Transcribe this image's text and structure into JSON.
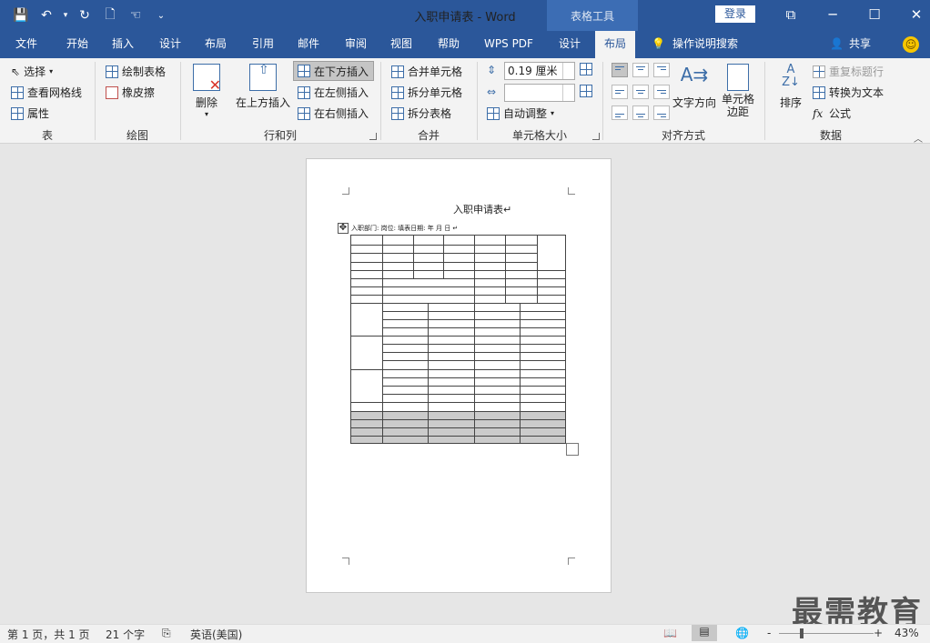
{
  "titlebar": {
    "document_title": "入职申请表 - Word",
    "context_title": "表格工具",
    "login_label": "登录",
    "qat_icons": [
      "save-icon",
      "undo-icon",
      "dropdown-caret-icon",
      "redo-icon",
      "new-document-icon",
      "touch-mode-icon",
      "customize-qat-icon"
    ],
    "window_icons": [
      "ribbon-display-icon",
      "minimize-icon",
      "maximize-icon",
      "close-icon"
    ]
  },
  "tabs": [
    {
      "label": "文件"
    },
    {
      "label": "开始"
    },
    {
      "label": "插入"
    },
    {
      "label": "设计"
    },
    {
      "label": "布局"
    },
    {
      "label": "引用"
    },
    {
      "label": "邮件"
    },
    {
      "label": "审阅"
    },
    {
      "label": "视图"
    },
    {
      "label": "帮助"
    },
    {
      "label": "WPS PDF"
    },
    {
      "label": "设计"
    },
    {
      "label": "布局",
      "active": true
    }
  ],
  "tellme": {
    "label": "操作说明搜索",
    "icon": "lightbulb-icon"
  },
  "share": {
    "label": "共享",
    "icon": "person-icon"
  },
  "ribbon": {
    "table": {
      "label": "表",
      "select": "选择",
      "view_gridlines": "查看网格线",
      "properties": "属性"
    },
    "draw": {
      "label": "绘图",
      "draw_table": "绘制表格",
      "eraser": "橡皮擦"
    },
    "rows_cols": {
      "label": "行和列",
      "delete": "删除",
      "insert_above": "在上方插入",
      "insert_below": "在下方插入",
      "insert_left": "在左侧插入",
      "insert_right": "在右侧插入"
    },
    "merge": {
      "label": "合并",
      "merge_cells": "合并单元格",
      "split_cells": "拆分单元格",
      "split_table": "拆分表格"
    },
    "cell_size": {
      "label": "单元格大小",
      "height_value": "0.19 厘米",
      "width_value": "",
      "autofit": "自动调整"
    },
    "alignment": {
      "label": "对齐方式",
      "text_direction": "文字方向",
      "cell_margins": "单元格\n边距"
    },
    "data": {
      "label": "数据",
      "sort": "排序",
      "repeat_header": "重复标题行",
      "convert_text": "转换为文本",
      "formula": "公式"
    }
  },
  "document": {
    "heading": "入职申请表↵",
    "info_line": "入职部门:     岗位:     填表日期:     年     月     日          ↵",
    "move_handle_icon": "table-move-handle-icon"
  },
  "watermark": "最需教育",
  "status": {
    "page": "第 1 页，共 1 页",
    "words": "21 个字",
    "proofing_icon": "proofing-icon",
    "language": "英语(美国)",
    "view_icons": [
      "read-mode-icon",
      "print-layout-icon",
      "web-layout-icon"
    ],
    "zoom_minus": "-",
    "zoom_plus": "+",
    "zoom": "43%"
  }
}
